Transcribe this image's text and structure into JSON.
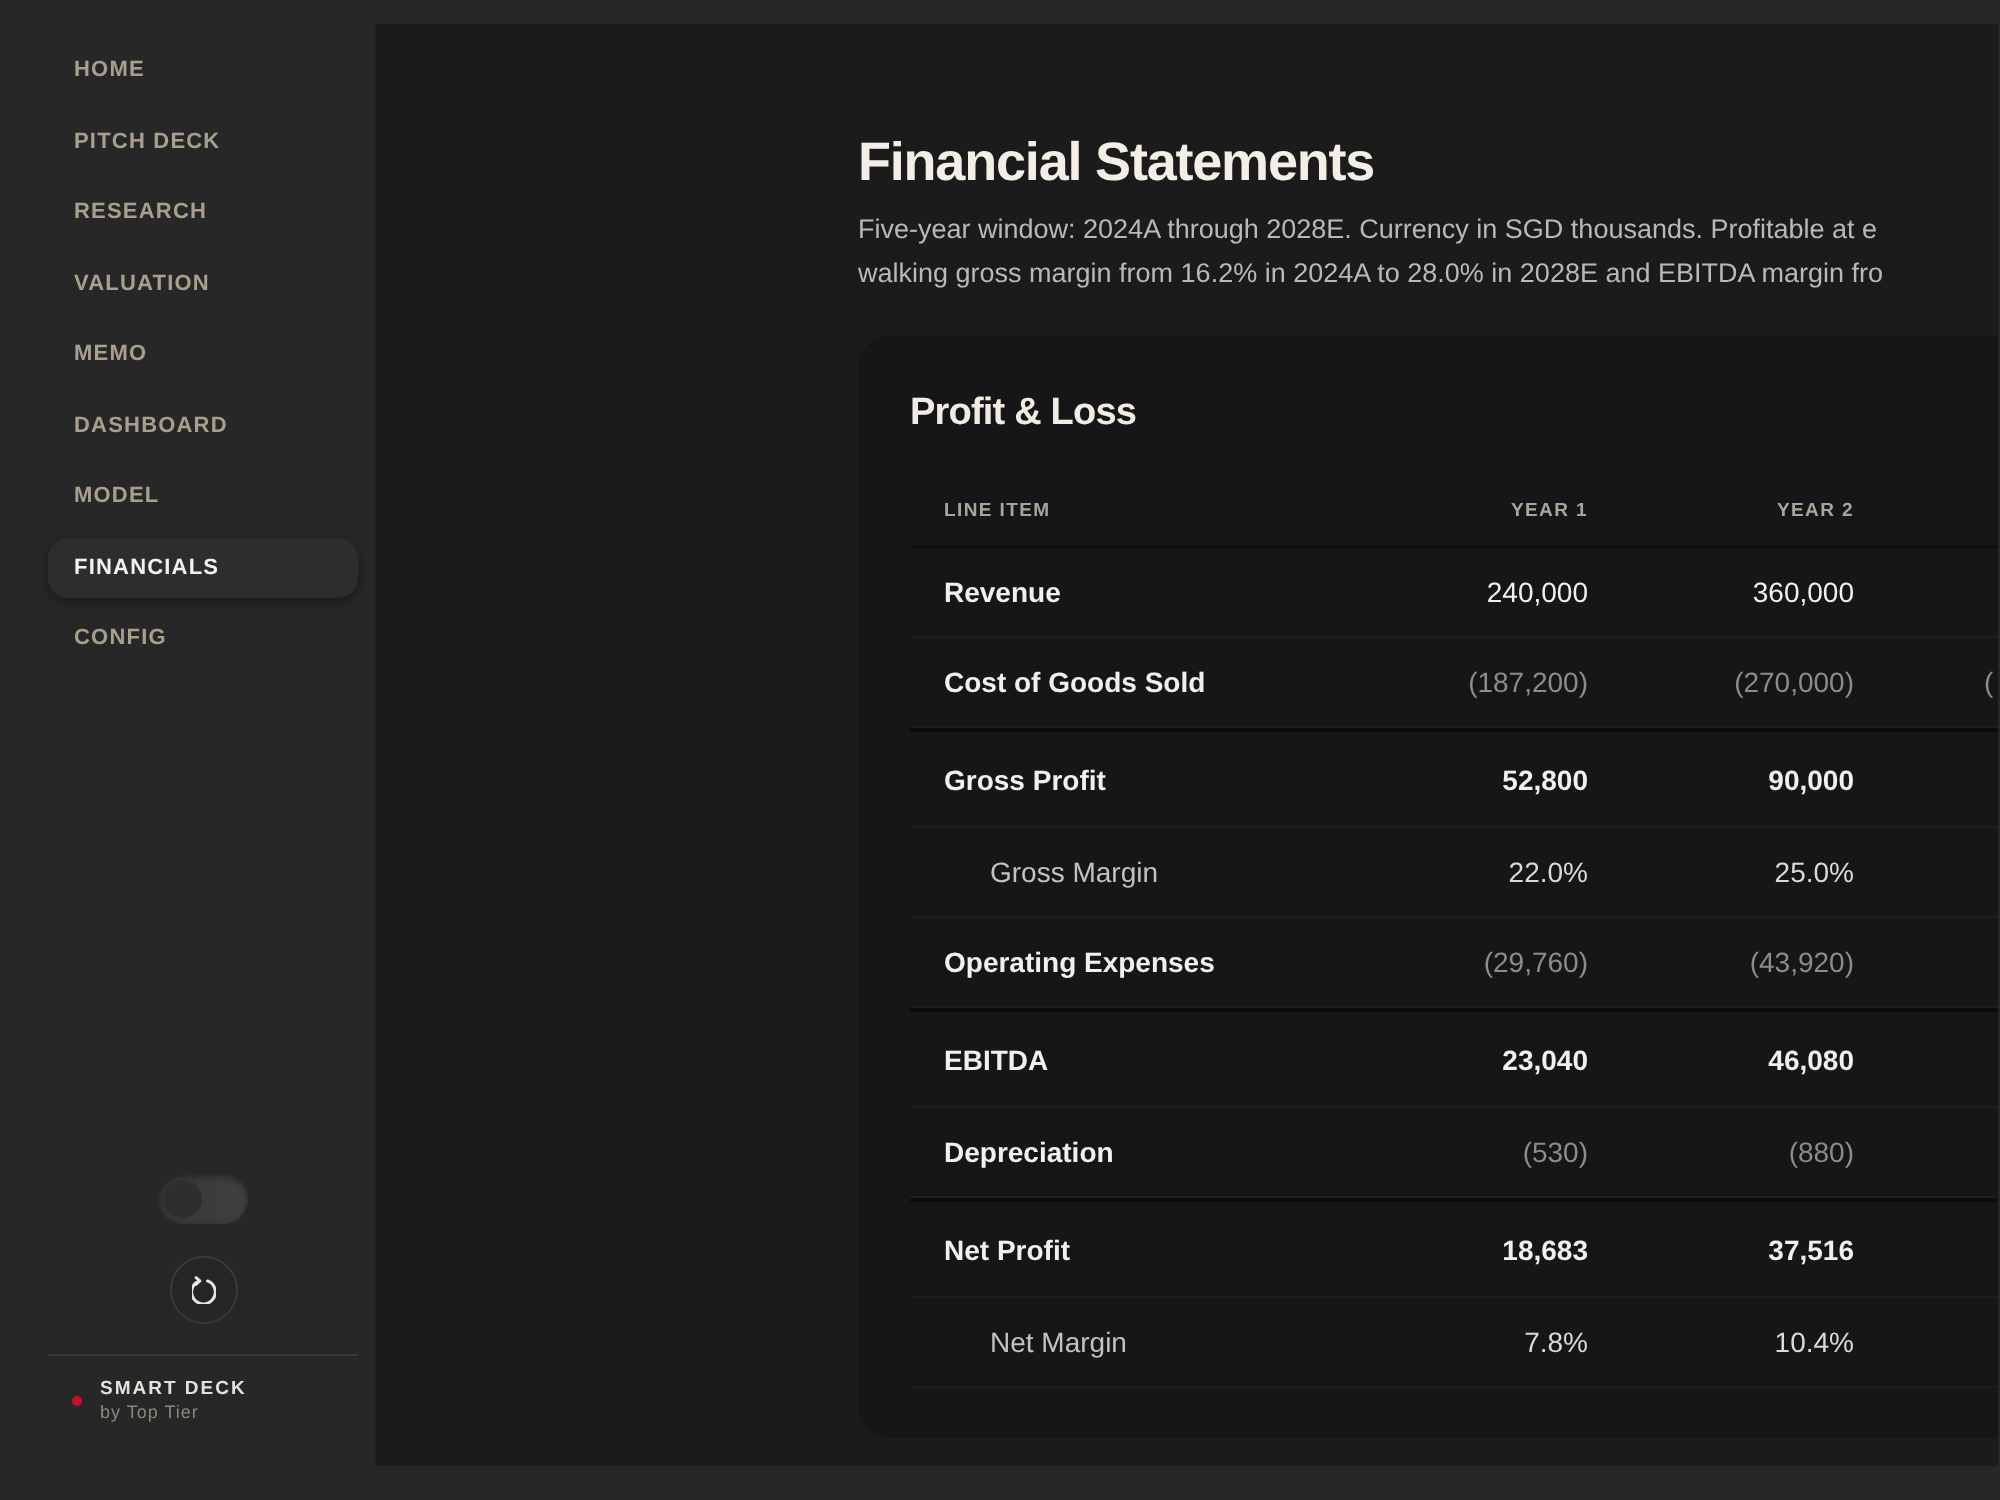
{
  "sidebar": {
    "items": [
      {
        "label": "HOME",
        "selected": false
      },
      {
        "label": "PITCH DECK",
        "selected": false
      },
      {
        "label": "RESEARCH",
        "selected": false
      },
      {
        "label": "VALUATION",
        "selected": false
      },
      {
        "label": "MEMO",
        "selected": false
      },
      {
        "label": "DASHBOARD",
        "selected": false
      },
      {
        "label": "MODEL",
        "selected": false
      },
      {
        "label": "FINANCIALS",
        "selected": true
      },
      {
        "label": "CONFIG",
        "selected": false
      }
    ],
    "toggle": {
      "on": false
    },
    "brand": {
      "name": "SMART DECK",
      "tagline": "by Top Tier"
    }
  },
  "page": {
    "title": "Financial Statements",
    "intro_lines": [
      "Five-year window: 2024A through 2028E. Currency in SGD thousands. Profitable at e",
      "walking gross margin from 16.2% in 2024A to 28.0% in 2028E and EBITDA margin fro"
    ]
  },
  "pnl": {
    "title": "Profit & Loss",
    "columns": [
      "LINE ITEM",
      "YEAR 1",
      "YEAR 2"
    ],
    "rows": [
      {
        "kind": "line",
        "label": "Revenue",
        "values": [
          "240,000",
          "360,000"
        ]
      },
      {
        "kind": "expense",
        "label": "Cost of Goods Sold",
        "values": [
          "(187,200)",
          "(270,000)",
          "("
        ]
      },
      {
        "kind": "total",
        "label": "Gross Profit",
        "values": [
          "52,800",
          "90,000"
        ]
      },
      {
        "kind": "ratio",
        "label": "Gross Margin",
        "values": [
          "22.0%",
          "25.0%"
        ]
      },
      {
        "kind": "expense",
        "label": "Operating Expenses",
        "values": [
          "(29,760)",
          "(43,920)"
        ]
      },
      {
        "kind": "total",
        "label": "EBITDA",
        "values": [
          "23,040",
          "46,080"
        ]
      },
      {
        "kind": "expense",
        "label": "Depreciation",
        "values": [
          "(530)",
          "(880)"
        ]
      },
      {
        "kind": "total",
        "label": "Net Profit",
        "values": [
          "18,683",
          "37,516"
        ]
      },
      {
        "kind": "ratio",
        "label": "Net Margin",
        "values": [
          "7.8%",
          "10.4%"
        ]
      }
    ]
  }
}
